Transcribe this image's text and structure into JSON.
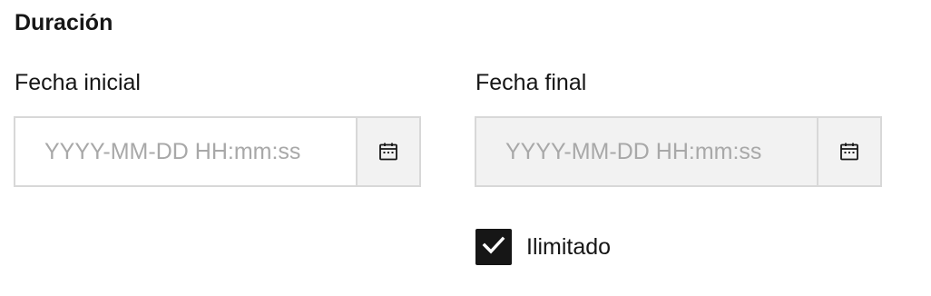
{
  "section": {
    "title": "Duración"
  },
  "start_date": {
    "label": "Fecha inicial",
    "placeholder": "YYYY-MM-DD HH:mm:ss",
    "value": "",
    "disabled": false,
    "icon": "calendar-icon"
  },
  "end_date": {
    "label": "Fecha final",
    "placeholder": "YYYY-MM-DD HH:mm:ss",
    "value": "",
    "disabled": true,
    "icon": "calendar-icon"
  },
  "unlimited": {
    "label": "Ilimitado",
    "checked": true,
    "icon": "checkmark-icon"
  },
  "colors": {
    "text": "#161616",
    "placeholder": "#a8a8a8",
    "border": "#d8d8d8",
    "disabled_bg": "#f2f2f2",
    "checkbox_fill": "#161616"
  }
}
